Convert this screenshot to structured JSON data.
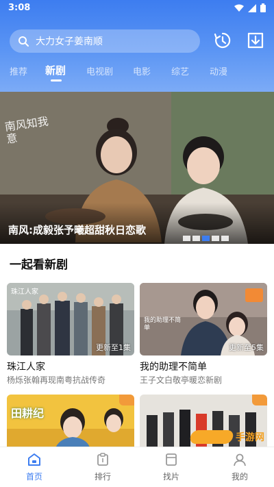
{
  "status": {
    "time": "3:08"
  },
  "search": {
    "query": "大力女子姜南顺"
  },
  "tabs": [
    {
      "label": "推荐"
    },
    {
      "label": "新剧"
    },
    {
      "label": "电视剧"
    },
    {
      "label": "电影"
    },
    {
      "label": "综艺"
    },
    {
      "label": "动漫"
    }
  ],
  "banner": {
    "caption": "南风:成毅张予曦超甜秋日恋歌",
    "logo_text": "南风知我意",
    "slide_count": 5,
    "active_slide": 2
  },
  "section": {
    "title": "一起看新剧"
  },
  "cards": [
    {
      "title": "珠江人家",
      "subtitle": "杨烁张翰再现南粤抗战传奇",
      "badge": "更新至1集",
      "poster_text": "珠江人家"
    },
    {
      "title": "我的助理不简单",
      "subtitle": "王子文白敬亭暖恋新剧",
      "badge": "更新至5集",
      "poster_text": "我的助理不简单"
    },
    {
      "poster_text": "田耕纪"
    },
    {
      "poster_text": ""
    }
  ],
  "watermark": {
    "text": "手游网"
  },
  "bottom_nav": [
    {
      "label": "首页",
      "icon": "home-icon",
      "active": true
    },
    {
      "label": "排行",
      "icon": "ranking-icon",
      "active": false
    },
    {
      "label": "找片",
      "icon": "find-icon",
      "active": false
    },
    {
      "label": "我的",
      "icon": "profile-icon",
      "active": false
    }
  ],
  "colors": {
    "accent": "#3d7df0",
    "badge_orange": "#f29a3a"
  }
}
